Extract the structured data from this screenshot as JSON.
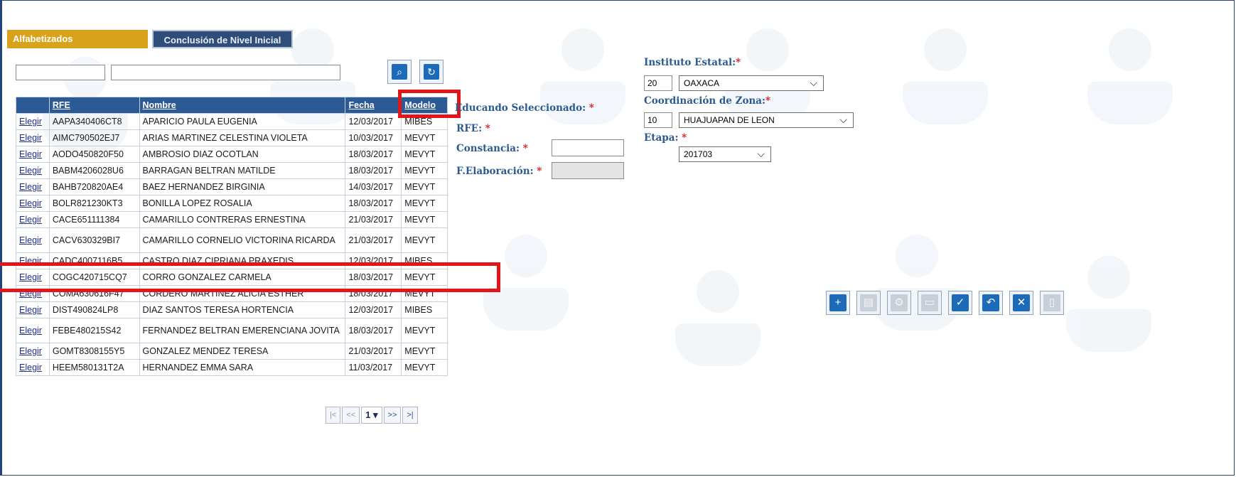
{
  "tabs": {
    "active": "Alfabetizados",
    "inactive": "Conclusión de Nivel Inicial"
  },
  "table": {
    "headers": {
      "select": "",
      "rfe": "RFE",
      "nombre": "Nombre",
      "fecha": "Fecha",
      "modelo": "Modelo"
    },
    "link_label": "Elegir",
    "rows": [
      {
        "rfe": "AAPA340406CT8",
        "nombre": "APARICIO PAULA EUGENIA",
        "fecha": "12/03/2017",
        "modelo": "MIBES"
      },
      {
        "rfe": "AIMC790502EJ7",
        "nombre": "ARIAS MARTINEZ CELESTINA VIOLETA",
        "fecha": "10/03/2017",
        "modelo": "MEVYT"
      },
      {
        "rfe": "AODO450820F50",
        "nombre": "AMBROSIO DIAZ OCOTLAN",
        "fecha": "18/03/2017",
        "modelo": "MEVYT"
      },
      {
        "rfe": "BABM4206028U6",
        "nombre": "BARRAGAN BELTRAN MATILDE",
        "fecha": "18/03/2017",
        "modelo": "MEVYT"
      },
      {
        "rfe": "BAHB720820AE4",
        "nombre": "BAEZ HERNANDEZ BIRGINIA",
        "fecha": "14/03/2017",
        "modelo": "MEVYT"
      },
      {
        "rfe": "BOLR821230KT3",
        "nombre": "BONILLA LOPEZ ROSALIA",
        "fecha": "18/03/2017",
        "modelo": "MEVYT"
      },
      {
        "rfe": "CACE651111384",
        "nombre": "CAMARILLO CONTRERAS ERNESTINA",
        "fecha": "21/03/2017",
        "modelo": "MEVYT"
      },
      {
        "rfe": "CACV630329BI7",
        "nombre": "CAMARILLO CORNELIO VICTORINA RICARDA",
        "fecha": "21/03/2017",
        "modelo": "MEVYT"
      },
      {
        "rfe": "CADC4007116B5",
        "nombre": "CASTRO DIAZ CIPRIANA PRAXEDIS",
        "fecha": "12/03/2017",
        "modelo": "MIBES"
      },
      {
        "rfe": "COGC420715CQ7",
        "nombre": "CORRO GONZALEZ CARMELA",
        "fecha": "18/03/2017",
        "modelo": "MEVYT"
      },
      {
        "rfe": "COMA630616F47",
        "nombre": "CORDERO MARTINEZ ALICIA ESTHER",
        "fecha": "18/03/2017",
        "modelo": "MEVYT"
      },
      {
        "rfe": "DIST490824LP8",
        "nombre": "DIAZ SANTOS TERESA HORTENCIA",
        "fecha": "12/03/2017",
        "modelo": "MIBES"
      },
      {
        "rfe": "FEBE480215S42",
        "nombre": "FERNANDEZ BELTRAN EMERENCIANA JOVITA",
        "fecha": "18/03/2017",
        "modelo": "MEVYT"
      },
      {
        "rfe": "GOMT8308155Y5",
        "nombre": "GONZALEZ MENDEZ TERESA",
        "fecha": "21/03/2017",
        "modelo": "MEVYT"
      },
      {
        "rfe": "HEEM580131T2A",
        "nombre": "HERNANDEZ EMMA SARA",
        "fecha": "11/03/2017",
        "modelo": "MEVYT"
      }
    ]
  },
  "pager": {
    "first": "|<",
    "prev": "<<",
    "page": "1 ▾",
    "next": ">>",
    "last": ">|"
  },
  "form": {
    "educando": "Educando Seleccionado:",
    "rfe": "RFE:",
    "constancia": "Constancia:",
    "felaboracion": "F.Elaboración:",
    "required": "*"
  },
  "right": {
    "instituto_label": "Instituto Estatal:",
    "instituto_num": "20",
    "instituto_name": "OAXACA",
    "coord_label": "Coordinación de Zona:",
    "coord_num": "10",
    "coord_name": "HUAJUAPAN DE LEON",
    "etapa_label": "Etapa:",
    "etapa_value": "201703"
  },
  "icons": {
    "search_btn": "search-document-icon",
    "refresh_btn": "refresh-document-icon",
    "toolbar": [
      "new-document-icon",
      "report-icon",
      "settings-document-icon",
      "print-icon",
      "accept-check-icon",
      "undo-icon",
      "cancel-x-icon",
      "exit-door-icon"
    ]
  },
  "colors": {
    "tab_active": "#d9a21b",
    "tab_inactive": "#2e4d78",
    "header": "#2c5a94",
    "label": "#2a5a90",
    "highlight": "#e0161a"
  }
}
